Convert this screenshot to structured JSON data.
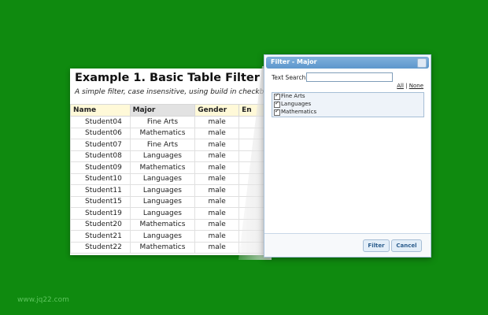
{
  "panel": {
    "title": "Example 1. Basic Table Filter",
    "subtitle": "A simple filter, case insensitive, using build in checkboxes"
  },
  "table": {
    "headers": [
      "Name",
      "Major",
      "Gender",
      "En"
    ],
    "rows": [
      [
        "Student04",
        "Fine Arts",
        "male"
      ],
      [
        "Student06",
        "Mathematics",
        "male"
      ],
      [
        "Student07",
        "Fine Arts",
        "male"
      ],
      [
        "Student08",
        "Languages",
        "male"
      ],
      [
        "Student09",
        "Mathematics",
        "male"
      ],
      [
        "Student10",
        "Languages",
        "male"
      ],
      [
        "Student11",
        "Languages",
        "male"
      ],
      [
        "Student15",
        "Languages",
        "male"
      ],
      [
        "Student19",
        "Languages",
        "male"
      ],
      [
        "Student20",
        "Mathematics",
        "male"
      ],
      [
        "Student21",
        "Languages",
        "male"
      ],
      [
        "Student22",
        "Mathematics",
        "male"
      ]
    ]
  },
  "dialog": {
    "title": "Filter - Major",
    "search_label": "Text Search",
    "search_value": "",
    "all_label": "All",
    "separator": "|",
    "none_label": "None",
    "options": [
      {
        "label": "Fine Arts",
        "checked": true
      },
      {
        "label": "Languages",
        "checked": true
      },
      {
        "label": "Mathematics",
        "checked": true
      }
    ],
    "filter_label": "Filter",
    "cancel_label": "Cancel"
  },
  "watermark": "www.jq22.com",
  "colors": {
    "background": "#0f8a0f",
    "header_yellow": "#fff9d8",
    "dialog_header": "#5d97cc"
  }
}
